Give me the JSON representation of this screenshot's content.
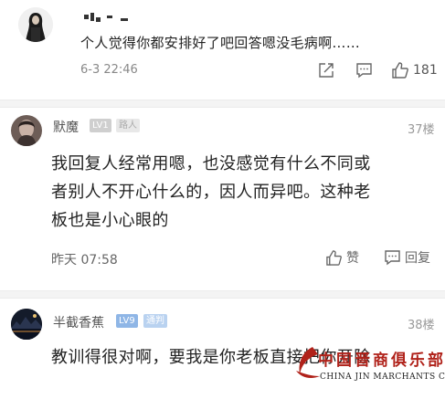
{
  "comment1": {
    "text": "个人觉得你都安排好了吧回答嗯没毛病啊……",
    "time": "6-3 22:46",
    "like_count": "181"
  },
  "comment2": {
    "username": "默魔",
    "badge_level": "LV1",
    "badge_tag": "路人",
    "floor": "37楼",
    "lines": [
      "我回复人经常用嗯，也没感觉有什么不同或",
      "者别人不开心什么的，因人而异吧。这种老",
      "板也是小心眼的"
    ],
    "time": "昨天 07:58",
    "like_label": "赞",
    "reply_label": "回复"
  },
  "comment3": {
    "username": "半截香蕉",
    "badge_level": "LV9",
    "badge_tag": "通判",
    "floor": "38楼",
    "text": "教训得很对啊，要我是你老板直接把你开除"
  },
  "watermark": {
    "cn": "中国晋商俱乐部",
    "en": "CHINA JIN MARCHANTS CLUB"
  },
  "colors": {
    "badge_lv1": "#cfcfcf",
    "badge_lv9": "#8fb6e6",
    "watermark_red": "#b0221a"
  }
}
